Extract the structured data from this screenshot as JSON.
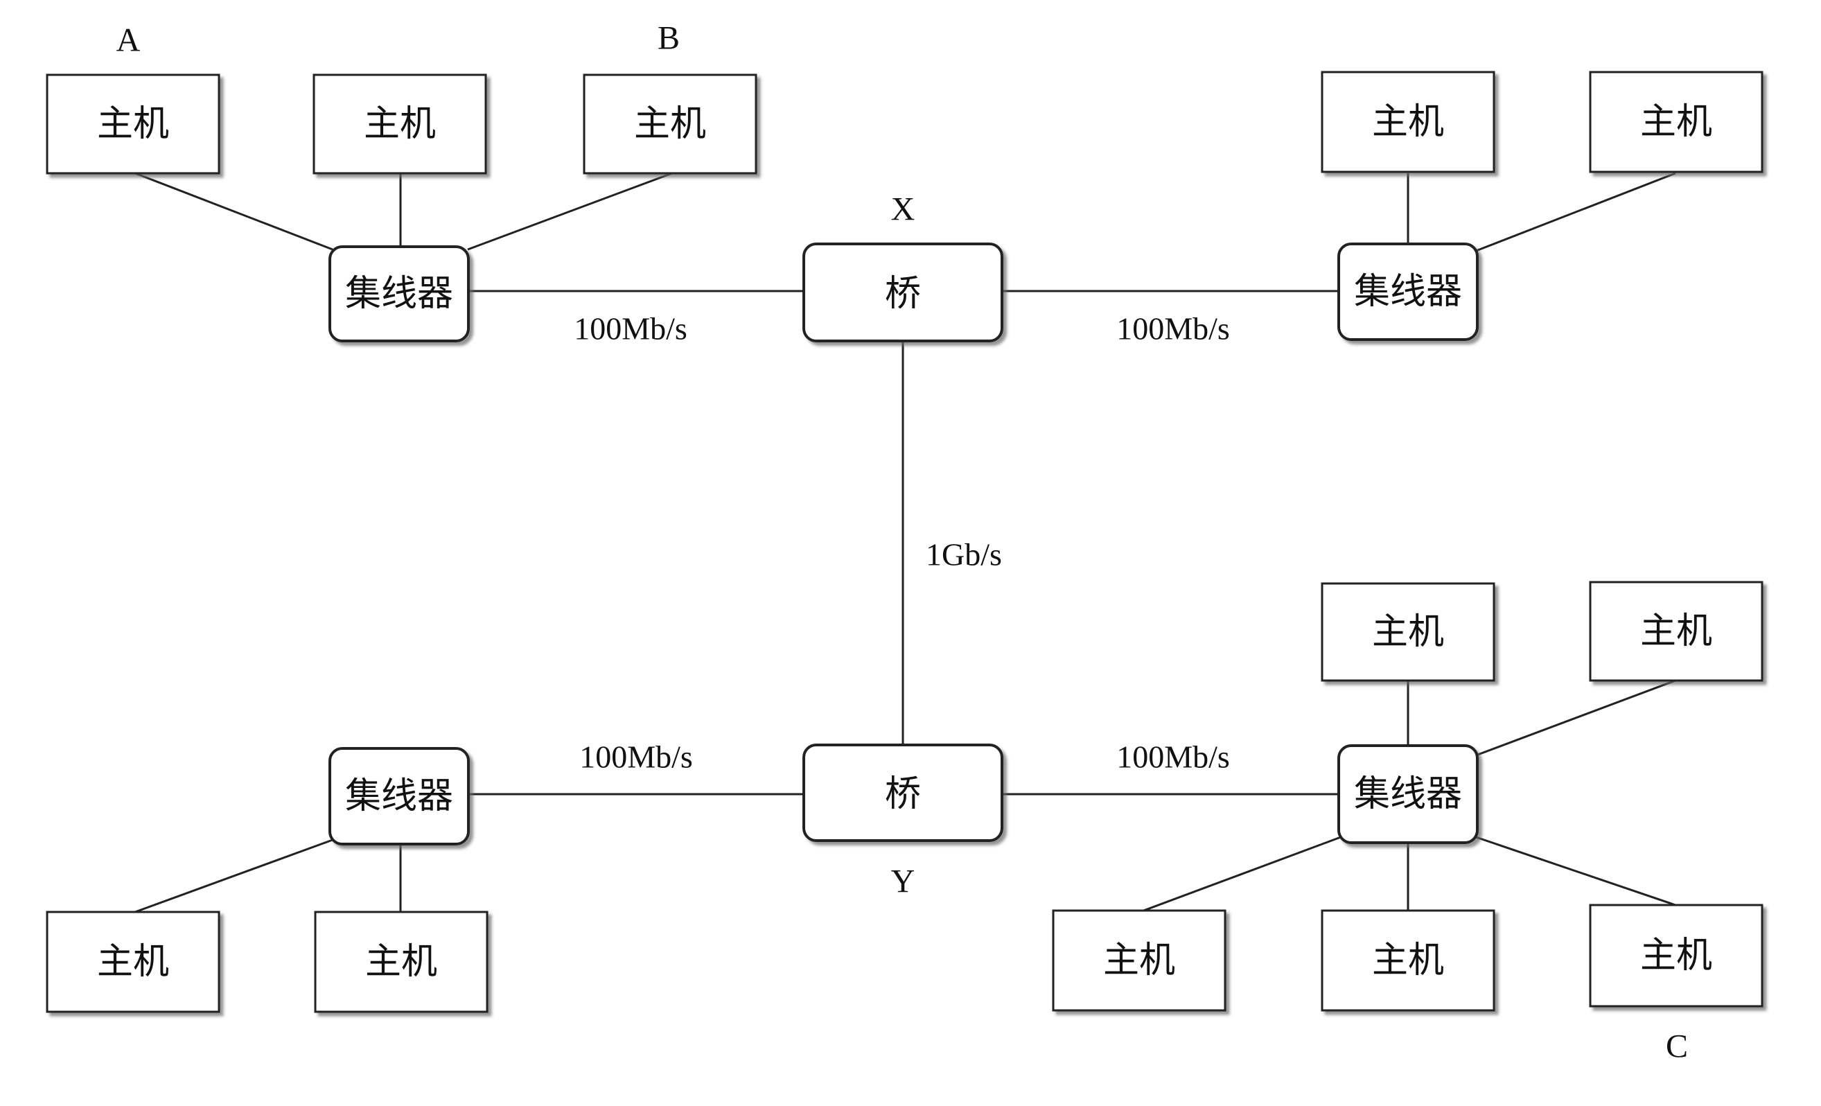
{
  "labels": {
    "host": "主机",
    "hub": "集线器",
    "bridge": "桥"
  },
  "node_letters": {
    "a": "A",
    "b": "B",
    "c": "C",
    "x": "X",
    "y": "Y"
  },
  "link_speeds": {
    "hub_top_left_to_bridge_x": "100Mb/s",
    "bridge_x_to_hub_top_right": "100Mb/s",
    "bridge_x_to_bridge_y": "1Gb/s",
    "hub_bottom_left_to_bridge_y": "100Mb/s",
    "bridge_y_to_hub_bottom_right": "100Mb/s"
  },
  "colors": {
    "line": "#222222",
    "box_stroke": "#222222",
    "box_fill": "#ffffff",
    "text": "#111111"
  }
}
